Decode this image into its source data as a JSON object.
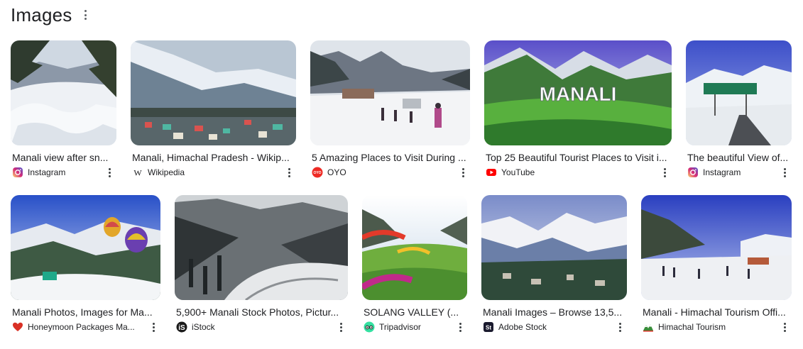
{
  "section": {
    "title": "Images",
    "more_icon": "vertical-dots-icon"
  },
  "results": [
    {
      "caption": "Manali view after sn...",
      "source": "Instagram",
      "source_icon": "instagram-icon"
    },
    {
      "caption": "Manali, Himachal Pradesh - Wikip...",
      "source": "Wikipedia",
      "source_icon": "wikipedia-icon"
    },
    {
      "caption": "5 Amazing Places to Visit During ...",
      "source": "OYO",
      "source_icon": "oyo-icon"
    },
    {
      "caption": "Top 25 Beautiful Tourist Places to Visit i...",
      "source": "YouTube",
      "source_icon": "youtube-icon",
      "overlay": "MANALI"
    },
    {
      "caption": "The beautiful View of...",
      "source": "Instagram",
      "source_icon": "instagram-icon"
    },
    {
      "caption": "Manali Photos, Images for Ma...",
      "source": "Honeymoon Packages Ma...",
      "source_icon": "heart-icon"
    },
    {
      "caption": "5,900+ Manali Stock Photos, Pictur...",
      "source": "iStock",
      "source_icon": "istock-icon"
    },
    {
      "caption": "SOLANG VALLEY (...",
      "source": "Tripadvisor",
      "source_icon": "tripadvisor-icon"
    },
    {
      "caption": "Manali Images – Browse 13,5...",
      "source": "Adobe Stock",
      "source_icon": "adobe-stock-icon"
    },
    {
      "caption": "Manali - Himachal Tourism Offi...",
      "source": "Himachal Tourism",
      "source_icon": "himachal-tourism-icon"
    }
  ],
  "colors": {
    "text": "#202124",
    "icon_gray": "#5f6368",
    "instagram": "#d6249f",
    "oyo": "#ee2a24",
    "youtube": "#ff0000",
    "heart": "#d93025",
    "tripadvisor": "#34e0a1"
  }
}
